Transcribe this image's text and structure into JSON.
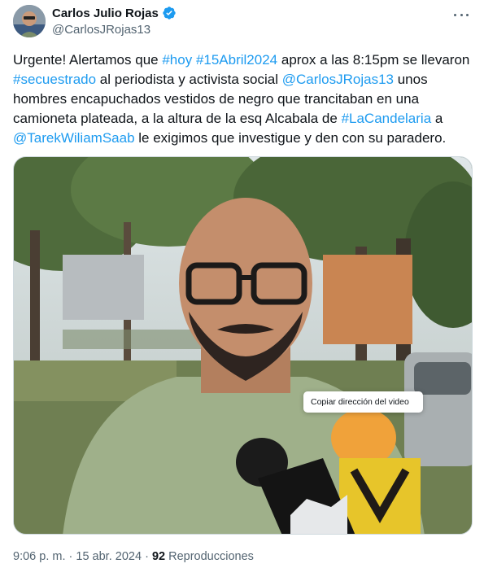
{
  "author": {
    "display_name": "Carlos Julio Rojas",
    "handle": "@CarlosJRojas13",
    "verified": true
  },
  "tweet": {
    "segments": [
      {
        "text": "Urgente! Alertamos que ",
        "link": false
      },
      {
        "text": "#hoy",
        "link": true
      },
      {
        "text": " ",
        "link": false
      },
      {
        "text": "#15Abril2024",
        "link": true
      },
      {
        "text": " aprox a las 8:15pm se llevaron ",
        "link": false
      },
      {
        "text": "#secuestrado",
        "link": true
      },
      {
        "text": " al periodista y activista social ",
        "link": false
      },
      {
        "text": "@CarlosJRojas13",
        "link": true
      },
      {
        "text": " unos hombres encapuchados vestidos de negro que trancitaban en una camioneta plateada, a la altura de la esq Alcabala de ",
        "link": false
      },
      {
        "text": "#LaCandelaria",
        "link": true
      },
      {
        "text": " a ",
        "link": false
      },
      {
        "text": "@TarekWiliamSaab",
        "link": true
      },
      {
        "text": " le exigimos que investigue y den con su paradero.",
        "link": false
      }
    ]
  },
  "media": {
    "context_menu_item": "Copiar dirección del video"
  },
  "meta": {
    "time": "9:06 p. m.",
    "separator": "·",
    "date": "15 abr. 2024",
    "views_count": "92",
    "views_label": "Reproducciones"
  },
  "colors": {
    "link": "#1d9bf0",
    "secondary_text": "#536471",
    "verified_badge": "#1d9bf0"
  },
  "icons": {
    "verified": "verified-badge-icon",
    "more": "more-options-icon"
  }
}
